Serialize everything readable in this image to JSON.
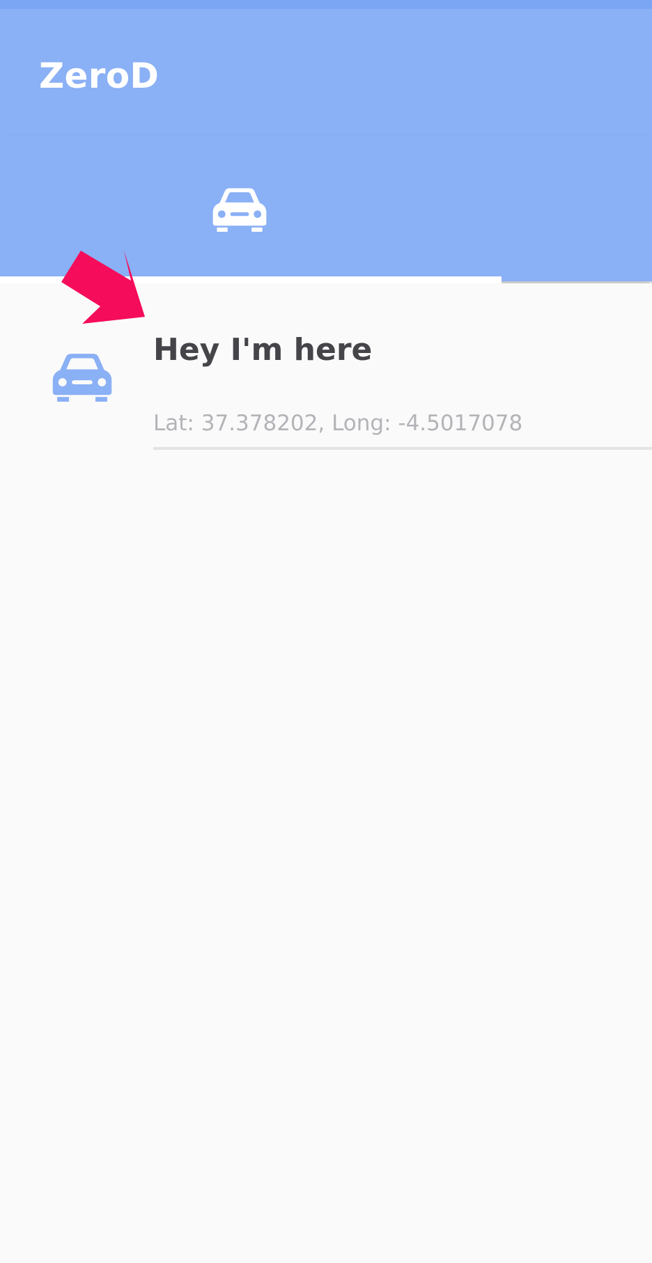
{
  "app": {
    "title": "ZeroD"
  },
  "tabs": [
    {
      "icon": "car-icon",
      "selected": true
    }
  ],
  "list": {
    "items": [
      {
        "icon": "car-icon",
        "title": "Hey I'm here",
        "subtitle": "Lat: 37.378202, Long: -4.5017078"
      }
    ]
  },
  "colors": {
    "status_bar": "#7aa6f4",
    "primary": "#8ab0f5",
    "background": "#fafafa",
    "title_text": "#444449",
    "subtitle_text": "#b3b3b8",
    "tab_indicator": "#ffffff",
    "arrow": "#f50c5a"
  }
}
